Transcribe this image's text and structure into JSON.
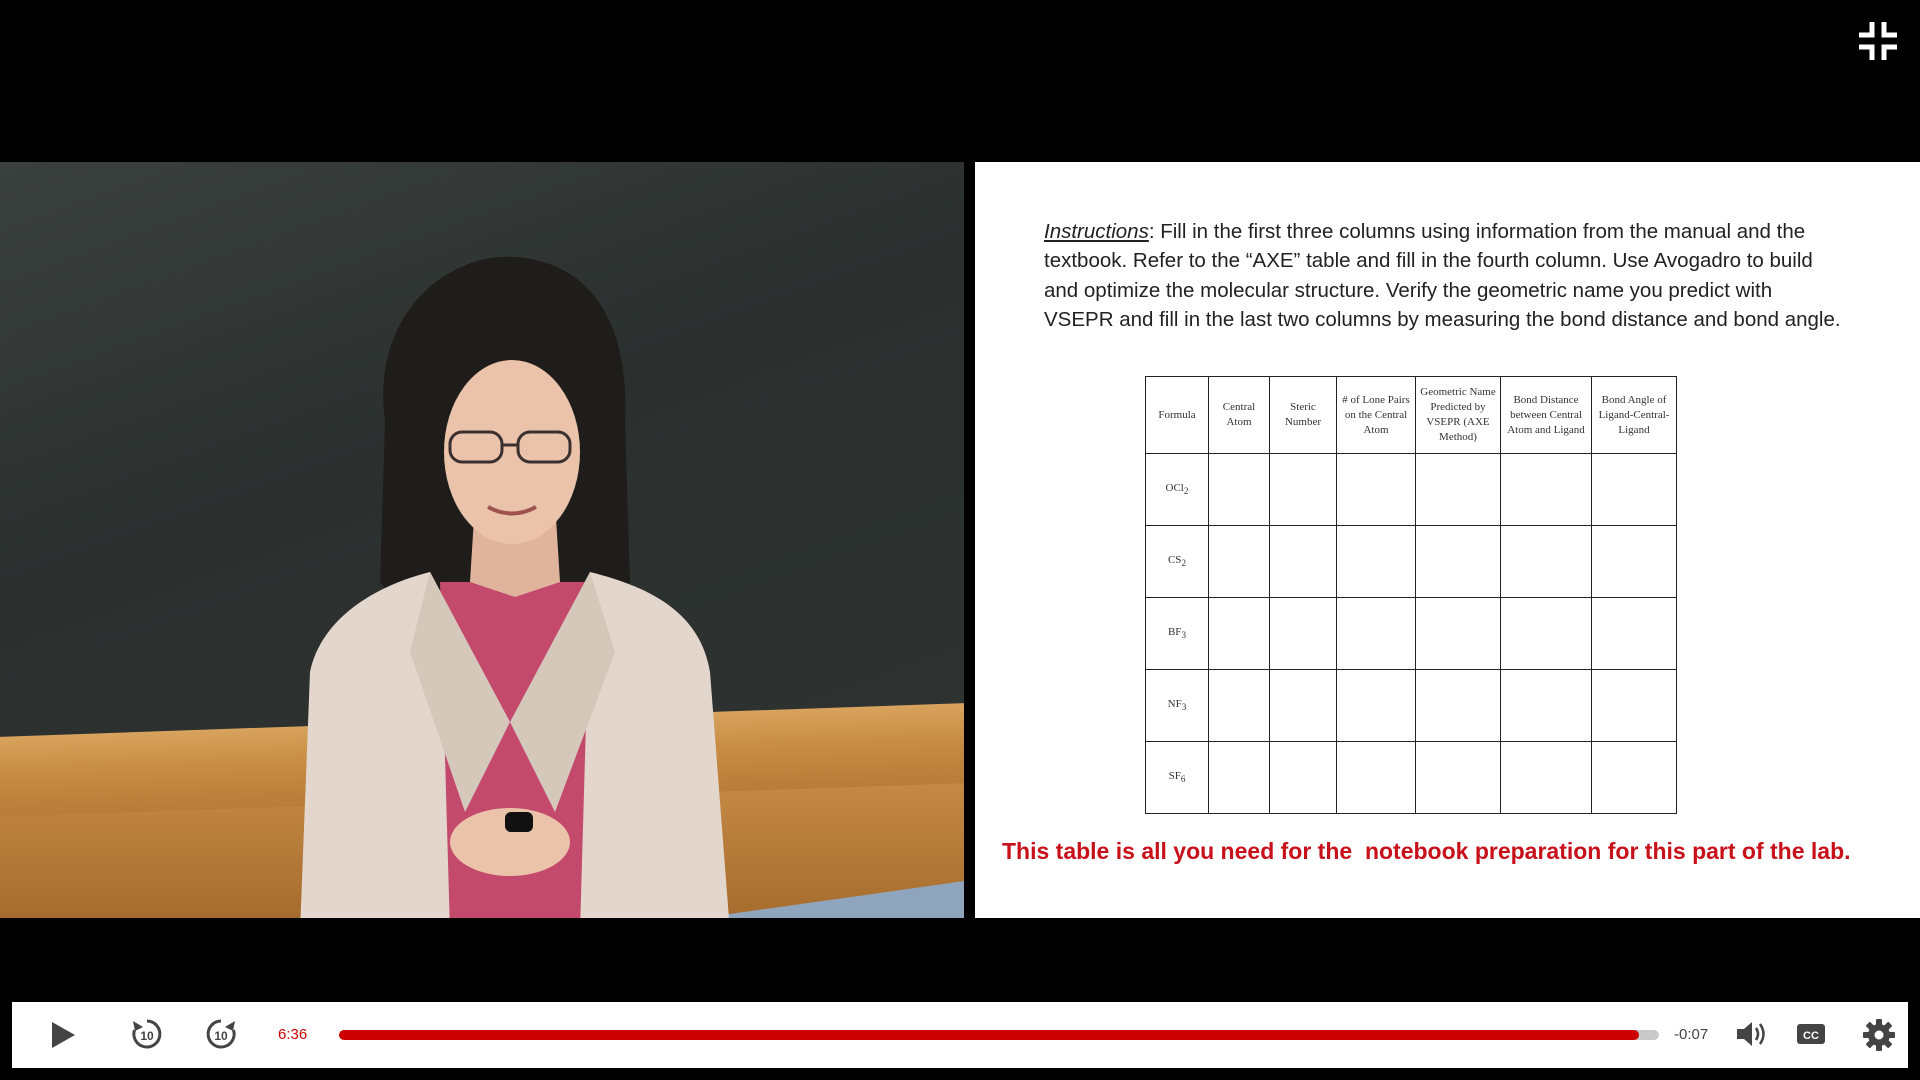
{
  "player": {
    "current_time": "6:36",
    "remaining_time": "-0:07",
    "progress": 0.985,
    "skip_back_seconds": "10",
    "skip_forward_seconds": "10",
    "captions_label": "CC",
    "accent_color": "#cc0000"
  },
  "slide": {
    "instructions_lead": "Instructions",
    "instructions_text": ": Fill in the first three columns using information from the manual and the textbook. Refer to the “AXE” table and fill in the fourth column. Use Avogadro to build and optimize the molecular structure. Verify the geometric name you predict with VSEPR and fill in the last two columns by measuring the bond distance and bond angle.",
    "table": {
      "headers": [
        "Formula",
        "Central Atom",
        "Steric Number",
        "# of Lone Pairs on the Central Atom",
        "Geometric Name Predicted by VSEPR (AXE Method)",
        "Bond Distance between Central Atom and Ligand",
        "Bond Angle of Ligand-Central-Ligand"
      ],
      "rows": [
        {
          "base": "OCl",
          "sub": "2"
        },
        {
          "base": "CS",
          "sub": "2"
        },
        {
          "base": "BF",
          "sub": "3"
        },
        {
          "base": "NF",
          "sub": "3"
        },
        {
          "base": "SF",
          "sub": "6"
        }
      ]
    },
    "note": "This table is all you need for the  notebook preparation for this part of the lab.",
    "note_color": "#c8101a"
  }
}
